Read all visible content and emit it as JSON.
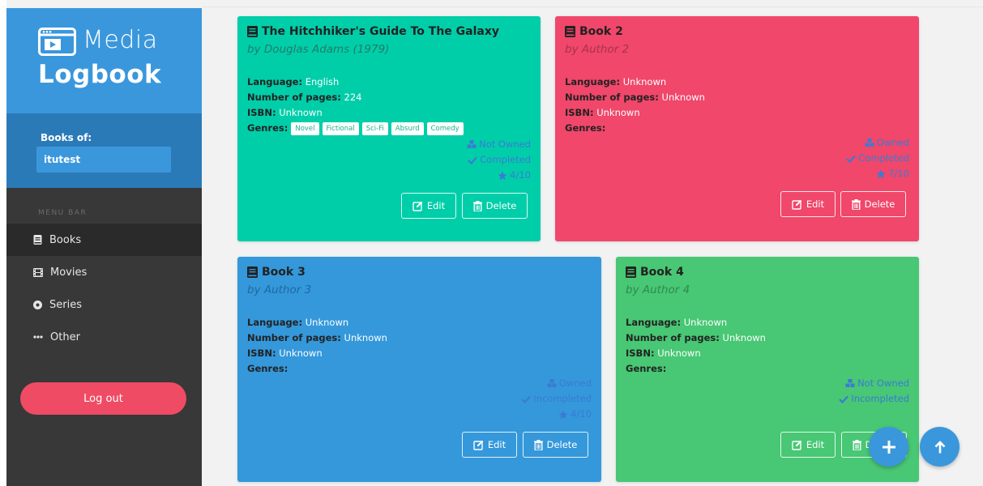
{
  "brand": {
    "line1": "Media",
    "line2": "Logbook"
  },
  "user": {
    "label": "Books of:",
    "name": "itutest"
  },
  "menu": {
    "section_label": "MENU BAR",
    "items": [
      {
        "label": "Books",
        "icon": "book-icon"
      },
      {
        "label": "Movies",
        "icon": "film-icon"
      },
      {
        "label": "Series",
        "icon": "disc-icon"
      },
      {
        "label": "Other",
        "icon": "ellipsis-icon"
      }
    ]
  },
  "logout_label": "Log out",
  "labels": {
    "language": "Language:",
    "pages": "Number of pages:",
    "isbn": "ISBN:",
    "genres": "Genres:",
    "edit": "Edit",
    "delete": "Delete"
  },
  "cards": [
    {
      "title": "The Hitchhiker's Guide To The Galaxy",
      "author": "by Douglas Adams (1979)",
      "language": "English",
      "pages": "224",
      "isbn": "Unknown",
      "genres": [
        "Novel",
        "Fictional",
        "Sci-Fi",
        "Absurd",
        "Comedy"
      ],
      "owned": "Not Owned",
      "completed": "Completed",
      "rating": "4/10",
      "color": "#00cea9"
    },
    {
      "title": "Book 2",
      "author": "by Author 2",
      "language": "Unknown",
      "pages": "Unknown",
      "isbn": "Unknown",
      "genres": [],
      "owned": "Owned",
      "completed": "Completed",
      "rating": "7/10",
      "color": "#f0476a"
    },
    {
      "title": "Book 3",
      "author": "by Author 3",
      "language": "Unknown",
      "pages": "Unknown",
      "isbn": "Unknown",
      "genres": [],
      "owned": "Owned",
      "completed": "Incompleted",
      "rating": "4/10",
      "color": "#3498db"
    },
    {
      "title": "Book 4",
      "author": "by Author 4",
      "language": "Unknown",
      "pages": "Unknown",
      "isbn": "Unknown",
      "genres": [],
      "owned": "Not Owned",
      "completed": "Incompleted",
      "rating": "",
      "color": "#48c774"
    }
  ],
  "colors": {
    "sidebar": "#383838",
    "brand": "#3a97dc",
    "user_panel": "#2b7ab8",
    "logout": "#ef4b65",
    "status_blue": "#3a7bd5",
    "fab": "#3a97dc"
  },
  "fabs": [
    {
      "icon": "plus-icon"
    },
    {
      "icon": "arrow-up-icon"
    }
  ]
}
